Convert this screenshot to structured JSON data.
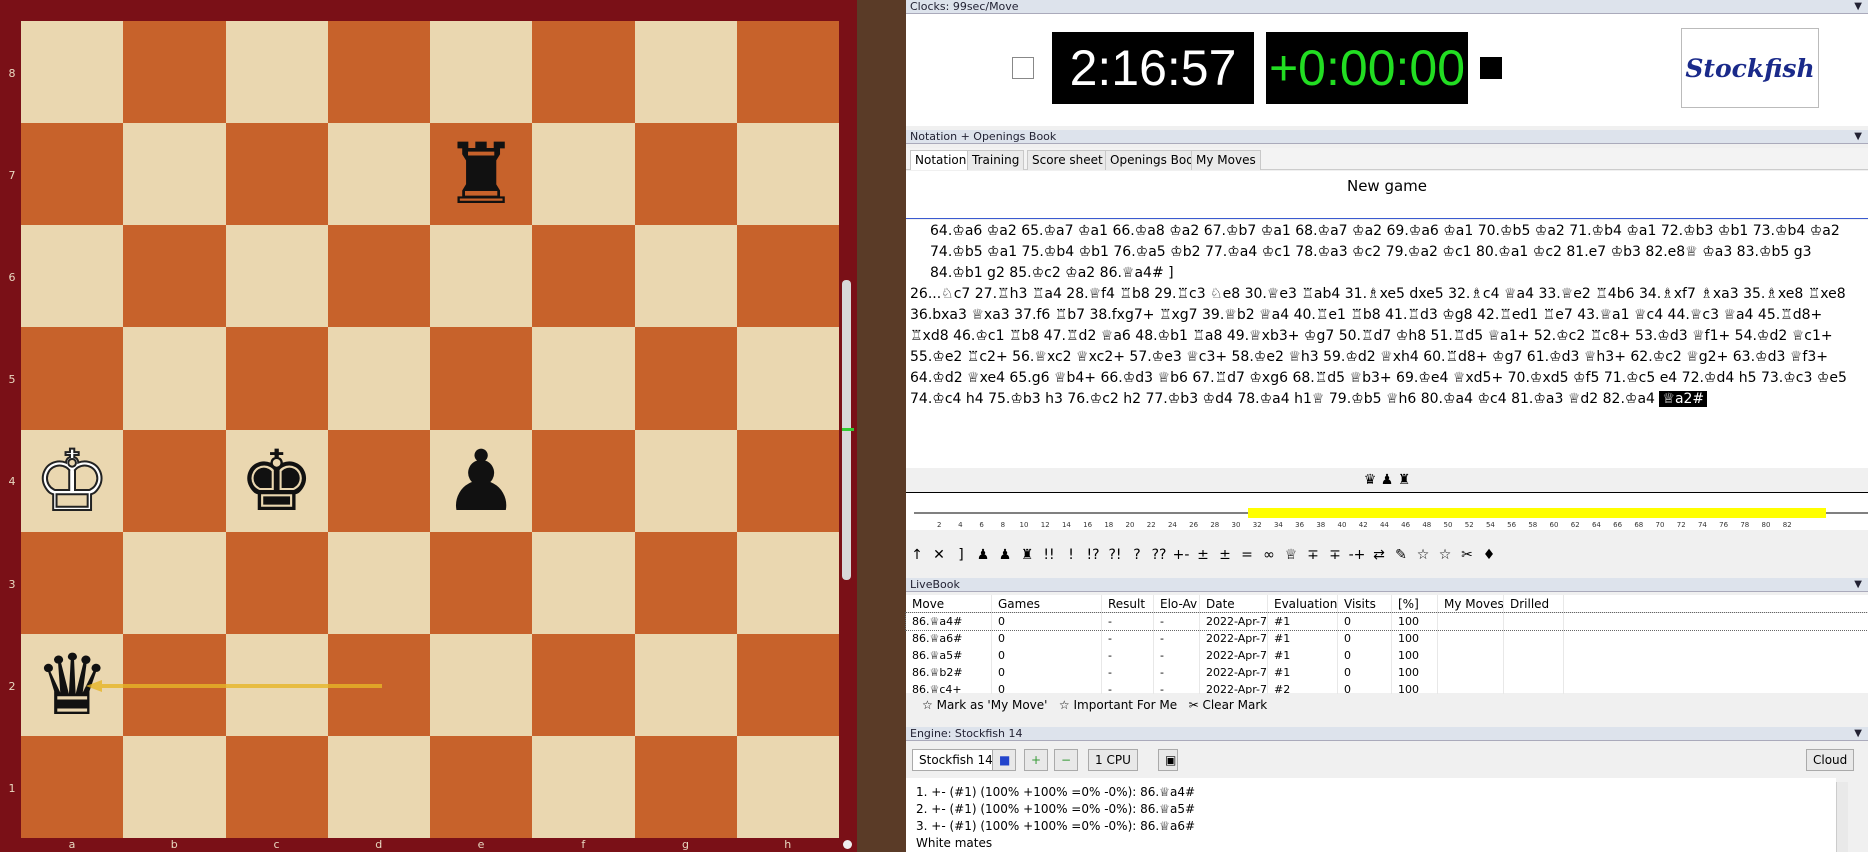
{
  "board": {
    "ranks": [
      "8",
      "7",
      "6",
      "5",
      "4",
      "3",
      "2",
      "1"
    ],
    "files": [
      "a",
      "b",
      "c",
      "d",
      "e",
      "f",
      "g",
      "h"
    ],
    "pieces": [
      {
        "square": "e7",
        "glyph": "♜",
        "color": "black",
        "name": "black-rook"
      },
      {
        "square": "a4",
        "glyph": "♔",
        "color": "white",
        "name": "white-king"
      },
      {
        "square": "c4",
        "glyph": "♚",
        "color": "black",
        "name": "black-king"
      },
      {
        "square": "e4",
        "glyph": "♟",
        "color": "black",
        "name": "black-pawn"
      },
      {
        "square": "a2",
        "glyph": "♛",
        "color": "black",
        "name": "black-queen"
      }
    ],
    "arrow_color": "#e6b527"
  },
  "clocks": {
    "header": "Clocks: 99sec/Move",
    "white_time": "2:16:57",
    "black_time": "+0:00:00",
    "white_color": "#ffffff",
    "black_color": "#22dd22",
    "engine_logo": "Stockfish"
  },
  "notation_panel": {
    "header": "Notation + Openings Book",
    "tabs": [
      "Notation",
      "Training",
      "Score sheet",
      "Openings Book",
      "My Moves"
    ],
    "title": "New game",
    "variation_line": "64.♔a6 ♔a2 65.♔a7 ♔a1 66.♔a8 ♔a2 67.♔b7 ♔a1 68.♔a7 ♔a2 69.♔a6 ♔a1 70.♔b5 ♔a2 71.♔b4 ♔a1 72.♔b3 ♔b1 73.♔b4 ♔a2 74.♔b5 ♔a1 75.♔b4 ♔b1 76.♔a5 ♔b2 77.♔a4 ♔c1 78.♔a3 ♔c2 79.♔a2 ♔c1 80.♔a1 ♔c2 81.e7 ♔b3 82.e8♕ ♔a3 83.♔b5 g3 84.♔b1 g2 85.♔c2 ♔a2 86.♕a4# ]",
    "main_line": "26...♘c7 27.♖h3 ♖a4 28.♕f4 ♖b8 29.♖c3 ♘e8 30.♕e3 ♖ab4 31.♗xe5 dxe5 32.♗c4 ♕a4 33.♕e2 ♖4b6 34.♗xf7 ♗xa3 35.♗xe8 ♖xe8 36.bxa3 ♕xa3 37.f6 ♖b7 38.fxg7+ ♖xg7 39.♕b2 ♕a4 40.♖e1 ♖b8 41.♖d3 ♔g8 42.♖ed1 ♖e7 43.♕a1 ♕c4 44.♕c3 ♕a4 45.♖d8+ ♖xd8 46.♔c1 ♖b8 47.♖d2 ♕a6 48.♔b1 ♖a8 49.♕xb3+ ♔g7 50.♖d7 ♔h8 51.♖d5 ♕a1+ 52.♔c2 ♖c8+ 53.♔d3 ♕f1+ 54.♔d2 ♕c1+ 55.♔e2 ♖c2+ 56.♕xc2 ♕xc2+ 57.♔e3 ♕c3+ 58.♔e2 ♕h3 59.♔d2 ♕xh4 60.♖d8+ ♔g7 61.♔d3 ♕h3+ 62.♔c2 ♕g2+ 63.♔d3 ♕f3+ 64.♔d2 ♕xe4 65.g6 ♕b4+ 66.♔d3 ♕b6 67.♖d7 ♔xg6 68.♖d5 ♕b3+ 69.♔e4 ♕xd5+ 70.♔xd5 ♔f5 71.♔c5 e4 72.♔d4 h5 73.♔c3 ♔e5 74.♔c4 h4 75.♔b3 h3 76.♔c2 h2 77.♔b3 ♔d4 78.♔a4 h1♕ 79.♔b5 ♕h6 80.♔a4 ♔c4 81.♔a3 ♕d2 82.♔a4",
    "current_move": "♕a2#",
    "material_icons": "♛ ♟ ♜"
  },
  "eval_graph": {
    "ticks": [
      "2",
      "4",
      "6",
      "8",
      "10",
      "12",
      "14",
      "16",
      "18",
      "20",
      "22",
      "24",
      "26",
      "28",
      "30",
      "32",
      "34",
      "36",
      "38",
      "40",
      "42",
      "44",
      "46",
      "48",
      "50",
      "52",
      "54",
      "56",
      "58",
      "60",
      "62",
      "64",
      "66",
      "68",
      "70",
      "72",
      "74",
      "76",
      "78",
      "80",
      "82"
    ],
    "current_color": "#ffff00",
    "annotation_symbols": [
      "↑",
      "✕",
      "]",
      "♟",
      "♟",
      "♜",
      "!!",
      "!",
      "!?",
      "?!",
      "?",
      "??",
      "+-",
      "±",
      "±",
      "=",
      "∞",
      "♕",
      "∓",
      "∓",
      "-+",
      "⇄",
      "✎",
      "☆",
      "☆",
      "✂",
      "♦"
    ]
  },
  "livebook": {
    "header": "LiveBook",
    "columns": [
      "Move",
      "Games",
      "Result",
      "Elo-Av",
      "Date",
      "Evaluation",
      "Visits",
      "[%]",
      "My Moves",
      "Drilled"
    ],
    "rows": [
      [
        "86.♕a4#",
        "0",
        "-",
        "-",
        "2022-Apr-7",
        "#1",
        "0",
        "100",
        "",
        ""
      ],
      [
        "86.♕a6#",
        "0",
        "-",
        "-",
        "2022-Apr-7",
        "#1",
        "0",
        "100",
        "",
        ""
      ],
      [
        "86.♕a5#",
        "0",
        "-",
        "-",
        "2022-Apr-7",
        "#1",
        "0",
        "100",
        "",
        ""
      ],
      [
        "86.♕b2#",
        "0",
        "-",
        "-",
        "2022-Apr-7",
        "#1",
        "0",
        "100",
        "",
        ""
      ],
      [
        "86.♕c4+",
        "0",
        "-",
        "-",
        "2022-Apr-7",
        "#2",
        "0",
        "100",
        "",
        ""
      ]
    ],
    "actions": [
      "Mark as 'My Move'",
      "Important For Me",
      "Clear Mark"
    ]
  },
  "engine": {
    "header": "Engine: Stockfish 14",
    "name_button": "Stockfish 14",
    "cpu_button": "1 CPU",
    "cloud_button": "Cloud",
    "lines": [
      "1. +- (#1) (100% +100% =0% -0%): 86.♕a4#",
      "2. +- (#1) (100% +100% =0% -0%): 86.♕a5#",
      "3. +- (#1) (100% +100% =0% -0%): 86.♕a6#",
      "White mates"
    ]
  }
}
